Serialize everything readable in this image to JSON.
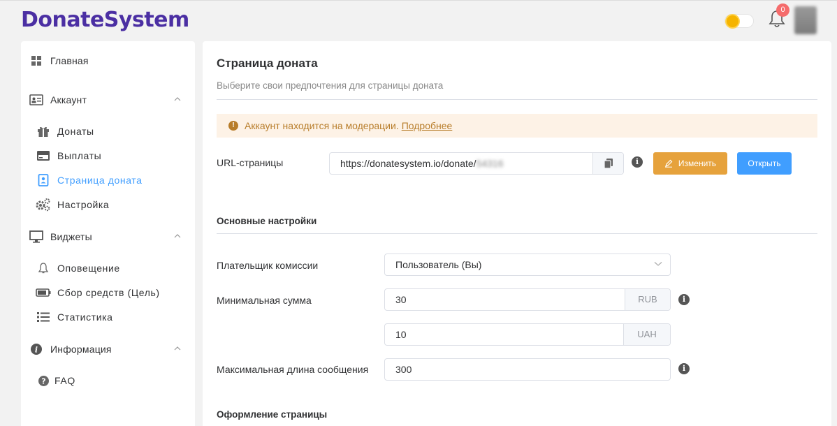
{
  "header": {
    "logo": "DonateSystem",
    "notifications_count": "0",
    "icons": {
      "theme": "sun-icon",
      "notifications": "bell-icon"
    }
  },
  "sidebar": {
    "main": {
      "label": "Главная",
      "icon": "grid-icon"
    },
    "account": {
      "label": "Аккаунт",
      "icon": "id-card-icon",
      "items": [
        {
          "label": "Донаты",
          "icon": "gift-icon"
        },
        {
          "label": "Выплаты",
          "icon": "credit-card-icon"
        },
        {
          "label": "Страница доната",
          "icon": "contact-book-icon",
          "active": true
        },
        {
          "label": "Настройка",
          "icon": "gears-icon"
        }
      ]
    },
    "widgets": {
      "label": "Виджеты",
      "icon": "monitor-icon",
      "items": [
        {
          "label": "Оповещение",
          "icon": "bell-outline-icon"
        },
        {
          "label": "Сбор средств (Цель)",
          "icon": "battery-icon"
        },
        {
          "label": "Статистика",
          "icon": "list-icon"
        }
      ]
    },
    "info": {
      "label": "Информация",
      "icon": "info-icon",
      "items": [
        {
          "label": "FAQ",
          "icon": "question-icon"
        }
      ]
    }
  },
  "page": {
    "title": "Страница доната",
    "subtitle": "Выберите свои предпочтения для страницы доната",
    "alert": {
      "text": "Аккаунт находится на модерации.",
      "link": "Подробнее"
    },
    "url": {
      "label": "URL-страницы",
      "value": "https://donatesystem.io/donate/",
      "value_hidden": "54316",
      "edit_label": "Изменить",
      "open_label": "Открыть"
    },
    "basic_settings": {
      "heading": "Основные настройки",
      "fee_payer": {
        "label": "Плательщик комиссии",
        "value": "Пользователь (Вы)"
      },
      "min_amount": {
        "label": "Минимальная сумма",
        "rub_value": "30",
        "rub_unit": "RUB",
        "uah_value": "10",
        "uah_unit": "UAH"
      },
      "max_message": {
        "label": "Максимальная длина сообщения",
        "value": "300"
      }
    },
    "design": {
      "heading": "Оформление страницы"
    }
  },
  "colors": {
    "accent": "#409eff",
    "warning": "#e6a23c",
    "brand": "#4b2fa3"
  }
}
